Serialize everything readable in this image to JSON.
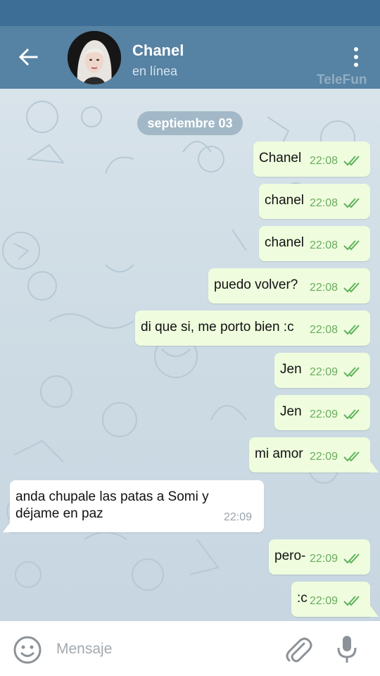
{
  "header": {
    "contact_name": "Chanel",
    "contact_status": "en línea",
    "watermark": "TeleFun"
  },
  "chat": {
    "date_label": "septiembre 03",
    "messages": [
      {
        "text": "Chanel",
        "time": "22:08",
        "direction": "out",
        "status": "read"
      },
      {
        "text": "chanel",
        "time": "22:08",
        "direction": "out",
        "status": "read"
      },
      {
        "text": "chanel",
        "time": "22:08",
        "direction": "out",
        "status": "read"
      },
      {
        "text": "puedo volver?",
        "time": "22:08",
        "direction": "out",
        "status": "read"
      },
      {
        "text": "di que si, me porto bien :c",
        "time": "22:08",
        "direction": "out",
        "status": "read"
      },
      {
        "text": "Jen",
        "time": "22:09",
        "direction": "out",
        "status": "read"
      },
      {
        "text": "Jen",
        "time": "22:09",
        "direction": "out",
        "status": "read"
      },
      {
        "text": "mi amor",
        "time": "22:09",
        "direction": "out",
        "status": "read"
      },
      {
        "text": "anda chupale las patas a Somi y déjame en paz",
        "time": "22:09",
        "direction": "in"
      },
      {
        "text": "pero-",
        "time": "22:09",
        "direction": "out",
        "status": "read"
      },
      {
        "text": ":c",
        "time": "22:09",
        "direction": "out",
        "status": "read"
      }
    ]
  },
  "composer": {
    "placeholder": "Mensaje"
  },
  "icons": {
    "back": "arrow-left-icon",
    "menu": "more-vertical-icon",
    "emoji": "emoji-icon",
    "attach": "paperclip-icon",
    "mic": "microphone-icon",
    "ticks": "double-check-icon"
  },
  "colors": {
    "header": "#5682a3",
    "statusbar": "#3c6e96",
    "outgoing_bubble": "#effdde",
    "incoming_bubble": "#ffffff",
    "read_ticks": "#5fb25c"
  }
}
